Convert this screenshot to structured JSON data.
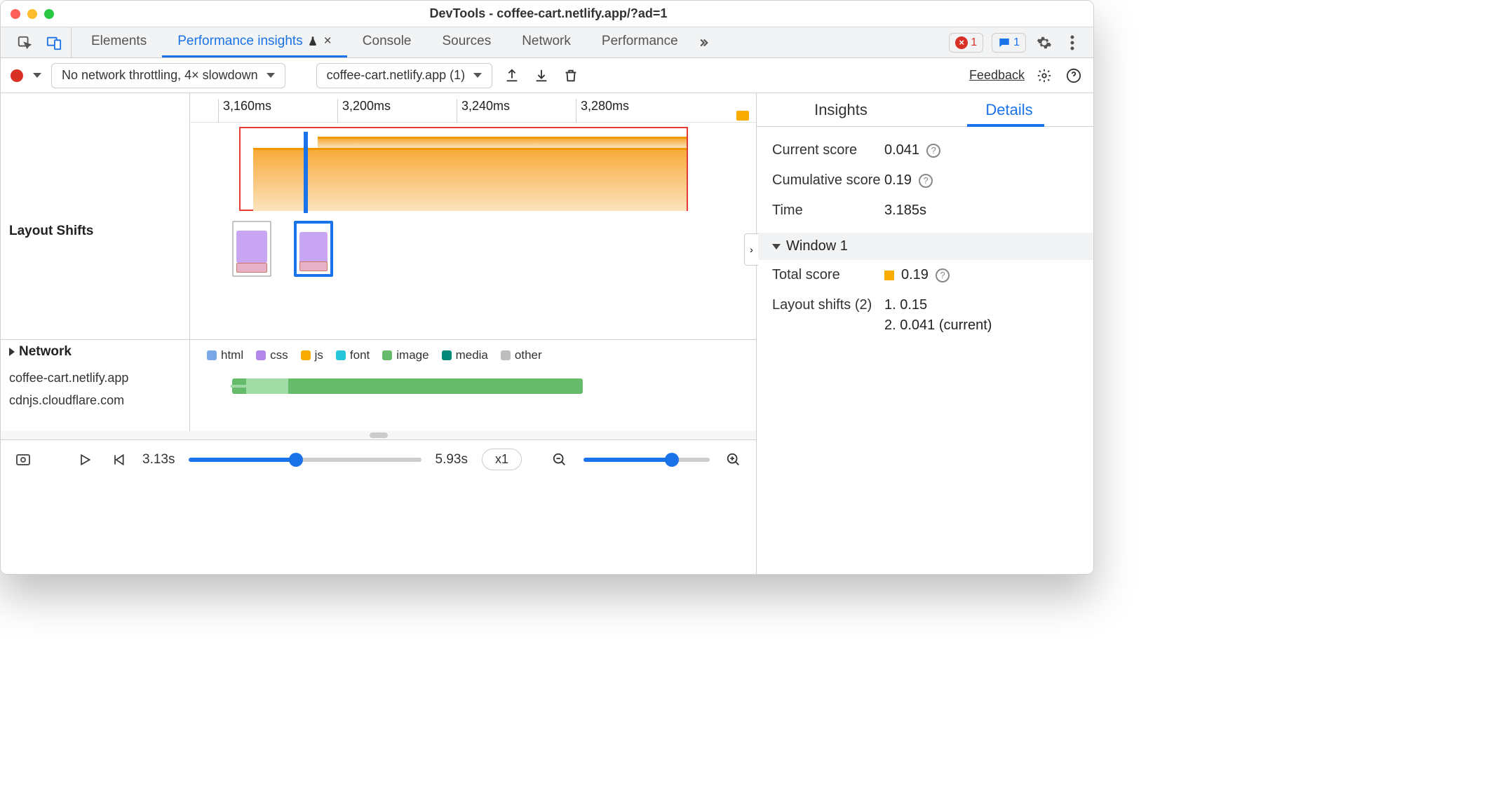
{
  "window": {
    "title": "DevTools - coffee-cart.netlify.app/?ad=1"
  },
  "tabs": {
    "items": [
      "Elements",
      "Performance insights",
      "Console",
      "Sources",
      "Network",
      "Performance"
    ],
    "active_index": 1,
    "errors_count": "1",
    "messages_count": "1"
  },
  "toolbar": {
    "throttle": "No network throttling, 4× slowdown",
    "recording": "coffee-cart.netlify.app (1)",
    "feedback": "Feedback"
  },
  "ruler": {
    "ticks": [
      "3,160ms",
      "3,200ms",
      "3,240ms",
      "3,280ms"
    ]
  },
  "tracks": {
    "layout_shifts_label": "Layout Shifts",
    "network_label": "Network"
  },
  "net_legend": {
    "items": [
      {
        "name": "html",
        "color": "#7AA7E8"
      },
      {
        "name": "css",
        "color": "#B388EB"
      },
      {
        "name": "js",
        "color": "#F9AB00"
      },
      {
        "name": "font",
        "color": "#26C6DA"
      },
      {
        "name": "image",
        "color": "#66BB6A"
      },
      {
        "name": "media",
        "color": "#00897B"
      },
      {
        "name": "other",
        "color": "#BDBDBD"
      }
    ],
    "hosts": [
      "coffee-cart.netlify.app",
      "cdnjs.cloudflare.com"
    ]
  },
  "playbar": {
    "start_time": "3.13s",
    "end_time": "5.93s",
    "speed": "x1"
  },
  "sidepanel": {
    "tabs": [
      "Insights",
      "Details"
    ],
    "active_index": 1,
    "current_score_label": "Current score",
    "current_score_value": "0.041",
    "cumulative_score_label": "Cumulative score",
    "cumulative_score_value": "0.19",
    "time_label": "Time",
    "time_value": "3.185s",
    "window_label": "Window 1",
    "total_score_label": "Total score",
    "total_score_value": "0.19",
    "layout_shifts_label": "Layout shifts (2)",
    "shift1": "1. 0.15",
    "shift2": "2. 0.041 (current)"
  }
}
